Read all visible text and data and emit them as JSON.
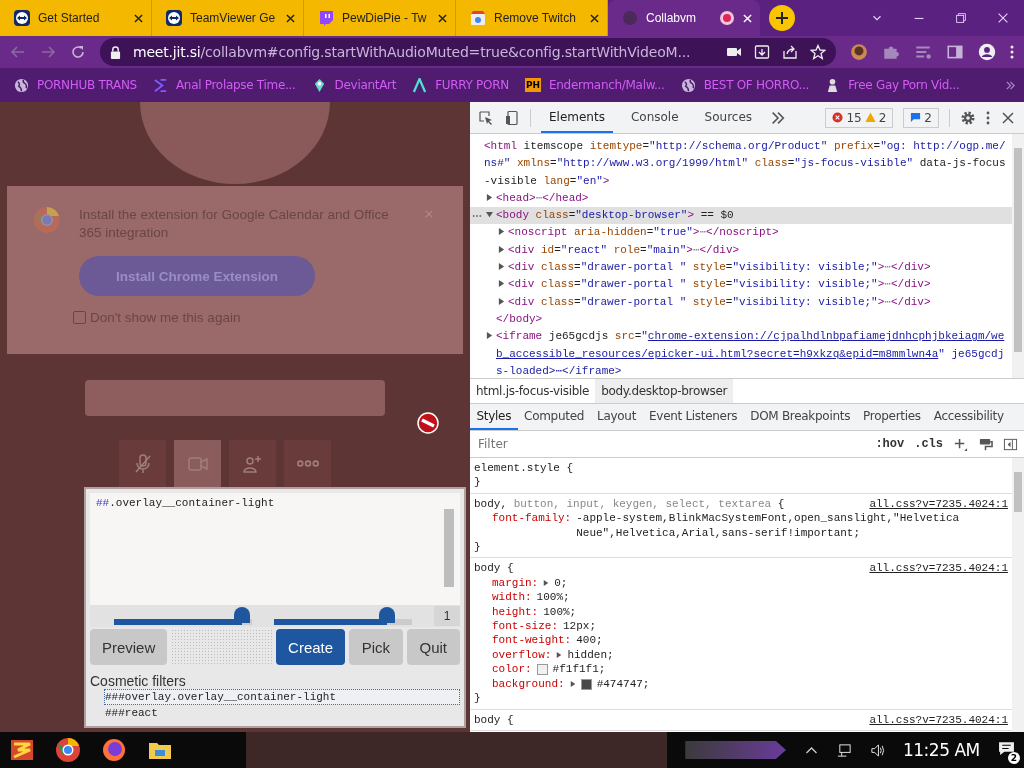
{
  "browser": {
    "tabs": [
      {
        "title": "Get Started",
        "selected": false,
        "recording": false
      },
      {
        "title": "TeamViewer Ge",
        "selected": false,
        "recording": false
      },
      {
        "title": "PewDiePie - Tw",
        "selected": false,
        "recording": false
      },
      {
        "title": "Remove Twitch",
        "selected": false,
        "recording": false
      },
      {
        "title": "Collabvm",
        "selected": true,
        "recording": true
      }
    ],
    "url_host": "meet.jit.si",
    "url_path": "/collabvm#config.startWithAudioMuted=true&config.startWithVideoM...",
    "bookmarks": [
      {
        "label": "PORNHUB TRANS"
      },
      {
        "label": "Anal Prolapse Time..."
      },
      {
        "label": "DeviantArt"
      },
      {
        "label": "FURRY PORN"
      },
      {
        "label": "Endermanch/Malw...",
        "badge": "PH"
      },
      {
        "label": "BEST OF HORRO..."
      },
      {
        "label": "Free Gay Porn Vid..."
      }
    ]
  },
  "page": {
    "notice": "Install the extension for Google Calendar and Office 365 integration",
    "install_button": "Install Chrome Extension",
    "dont_show": {
      "label": "Don't show me this again",
      "checked": false
    },
    "controls": [
      {
        "selected": false
      },
      {
        "selected": true
      },
      {
        "selected": false
      },
      {
        "selected": false
      }
    ]
  },
  "picker": {
    "filter_text": "##.overlay__container-light",
    "sliders": [
      {
        "level": 0.93
      },
      {
        "level": 0.82
      }
    ],
    "count": "1",
    "buttons": [
      {
        "label": "Preview",
        "kind": "secondary"
      },
      {
        "label": "Create",
        "kind": "primary"
      },
      {
        "label": "Pick",
        "kind": "secondary"
      },
      {
        "label": "Quit",
        "kind": "secondary"
      }
    ],
    "cosmetic_heading": "Cosmetic filters",
    "filters": [
      {
        "text": "###overlay.overlay__container-light",
        "selected": true
      },
      {
        "text": "###react",
        "selected": false
      }
    ]
  },
  "devtools": {
    "tabs": [
      {
        "label": "Elements",
        "selected": true
      },
      {
        "label": "Console",
        "selected": false
      },
      {
        "label": "Sources",
        "selected": false
      }
    ],
    "errors": "15",
    "warnings": "2",
    "messages": "2",
    "dom": [
      {
        "text": "<html itemscope itemtype=\"http://schema.org/Product\" prefix=\"og: http://ogp.me/ns#\" xmlns=\"http://www.w3.org/1999/html\" class=\"js-focus-visible\" data-js-focus-visible lang=\"en\">",
        "selected": false,
        "children": [
          {
            "text": "<head>⋯</head>",
            "expanded": false,
            "selected": false
          },
          {
            "text": "<body class=\"desktop-browser\"> == $0",
            "expanded": true,
            "selected": true,
            "closing": "</body>",
            "children": [
              {
                "text": "<noscript aria-hidden=\"true\">⋯</noscript>",
                "expanded": false,
                "selected": false
              },
              {
                "text": "<div id=\"react\" role=\"main\">⋯</div>",
                "expanded": false,
                "selected": false
              },
              {
                "text": "<div class=\"drawer-portal \" style=\"visibility: visible;\">⋯</div>",
                "expanded": false,
                "selected": false
              },
              {
                "text": "<div class=\"drawer-portal \" style=\"visibility: visible;\">⋯</div>",
                "expanded": false,
                "selected": false
              },
              {
                "text": "<div class=\"drawer-portal \" style=\"visibility: visible;\">⋯</div>",
                "expanded": false,
                "selected": false
              }
            ]
          },
          {
            "text": "<iframe je65gcdjs src=\"",
            "link": "chrome-extension://cjpalhdlnbpafiamejdnhcphjbkeiagm/web_accessible_resources/epicker-ui.html?secret=h9xkzq&epid=m8mmlwn4a",
            "after": "\" je65gcdjs-loaded>⋯</iframe>",
            "expanded": false,
            "selected": false
          }
        ]
      }
    ],
    "breadcrumbs": [
      {
        "text": "html.js-focus-visible",
        "selected": false
      },
      {
        "text": "body.desktop-browser",
        "selected": true
      }
    ],
    "style_tabs": [
      {
        "label": "Styles",
        "selected": true
      },
      {
        "label": "Computed",
        "selected": false
      },
      {
        "label": "Layout",
        "selected": false
      },
      {
        "label": "Event Listeners",
        "selected": false
      },
      {
        "label": "DOM Breakpoints",
        "selected": false
      },
      {
        "label": "Properties",
        "selected": false
      },
      {
        "label": "Accessibility",
        "selected": false
      }
    ],
    "filter_placeholder": "Filter",
    "hov": ":hov",
    "cls": ".cls",
    "rules": [
      {
        "selector": [
          {
            "text": "element.style",
            "matched": true
          }
        ],
        "open": "{",
        "close": "}"
      },
      {
        "selector": [
          {
            "text": "body,",
            "matched": true
          },
          {
            "text": "button,",
            "matched": false
          },
          {
            "text": "input,",
            "matched": false
          },
          {
            "text": "keygen,",
            "matched": false
          },
          {
            "text": "select,",
            "matched": false
          },
          {
            "text": "textarea",
            "matched": false
          }
        ],
        "open": "{",
        "source": "all.css?v=7235.4024:1",
        "close": "}",
        "props": [
          {
            "name": "font-family:",
            "value": "-apple-system,BlinkMacSystemFont,open_sanslight,\"Helvetica Neue\",Helvetica,Arial,sans-serif!important;"
          }
        ]
      },
      {
        "selector": [
          {
            "text": "body",
            "matched": true
          }
        ],
        "open": "{",
        "source": "all.css?v=7235.4024:1",
        "close": "}",
        "props": [
          {
            "name": "margin:",
            "value": "0;",
            "expandable": true
          },
          {
            "name": "width:",
            "value": "100%;"
          },
          {
            "name": "height:",
            "value": "100%;"
          },
          {
            "name": "font-size:",
            "value": "12px;"
          },
          {
            "name": "font-weight:",
            "value": "400;"
          },
          {
            "name": "overflow:",
            "value": "hidden;",
            "expandable": true
          },
          {
            "name": "color:",
            "value": "#f1f1f1;",
            "swatch": true
          },
          {
            "name": "background:",
            "value": "#474747;",
            "expandable": true,
            "swatch": true
          }
        ]
      },
      {
        "selector": [
          {
            "text": "body",
            "matched": true
          }
        ],
        "open": "{",
        "source": "all.css?v=7235.4024:1"
      }
    ]
  },
  "taskbar": {
    "time": "11:25 AM",
    "notifications": "2"
  }
}
